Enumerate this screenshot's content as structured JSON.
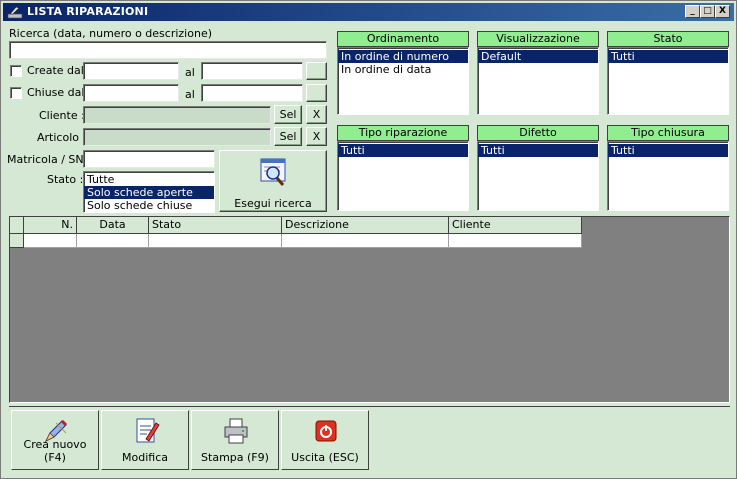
{
  "window": {
    "title": "LISTA RIPARAZIONI",
    "minimize": "_",
    "maximize": "□",
    "close": "X"
  },
  "search": {
    "label": "Ricerca (data, numero o descrizione)",
    "value": ""
  },
  "created": {
    "label": "Create dal",
    "al": "al",
    "from": "",
    "to": ""
  },
  "closed": {
    "label": "Chiuse dal",
    "al": "al",
    "from": "",
    "to": ""
  },
  "cliente": {
    "label": "Cliente :",
    "value": "",
    "sel": "Sel",
    "clear": "X"
  },
  "articolo": {
    "label": "Articolo :",
    "value": "",
    "sel": "Sel",
    "clear": "X"
  },
  "matricola": {
    "label": "Matricola / SN:",
    "value": ""
  },
  "stato_filter": {
    "label": "Stato :",
    "options": [
      "Tutte",
      "Solo schede aperte",
      "Solo schede chiuse"
    ],
    "selected_index": 1
  },
  "search_button": {
    "label": "Esegui ricerca"
  },
  "panels": [
    {
      "key": "ordinamento",
      "title": "Ordinamento",
      "items": [
        "In ordine di numero",
        "In ordine di data"
      ],
      "selected_index": 0
    },
    {
      "key": "visualizzazione",
      "title": "Visualizzazione",
      "items": [
        "Default"
      ],
      "selected_index": 0
    },
    {
      "key": "stato",
      "title": "Stato",
      "items": [
        "Tutti"
      ],
      "selected_index": 0
    },
    {
      "key": "tipo-riparazione",
      "title": "Tipo riparazione",
      "items": [
        "Tutti"
      ],
      "selected_index": 0
    },
    {
      "key": "difetto",
      "title": "Difetto",
      "items": [
        "Tutti"
      ],
      "selected_index": 0
    },
    {
      "key": "tipo-chiusura",
      "title": "Tipo chiusura",
      "items": [
        "Tutti"
      ],
      "selected_index": 0
    }
  ],
  "grid": {
    "columns": [
      "N.",
      "Data",
      "Stato",
      "Descrizione",
      "Cliente"
    ]
  },
  "actions": {
    "new": "Crea nuovo (F4)",
    "edit": "Modifica",
    "print": "Stampa (F9)",
    "exit": "Uscita (ESC)"
  },
  "colors": {
    "background": "#d4e8d4",
    "panel_header": "#90ee90",
    "selection": "#0a246a",
    "grid_empty": "#808080"
  }
}
